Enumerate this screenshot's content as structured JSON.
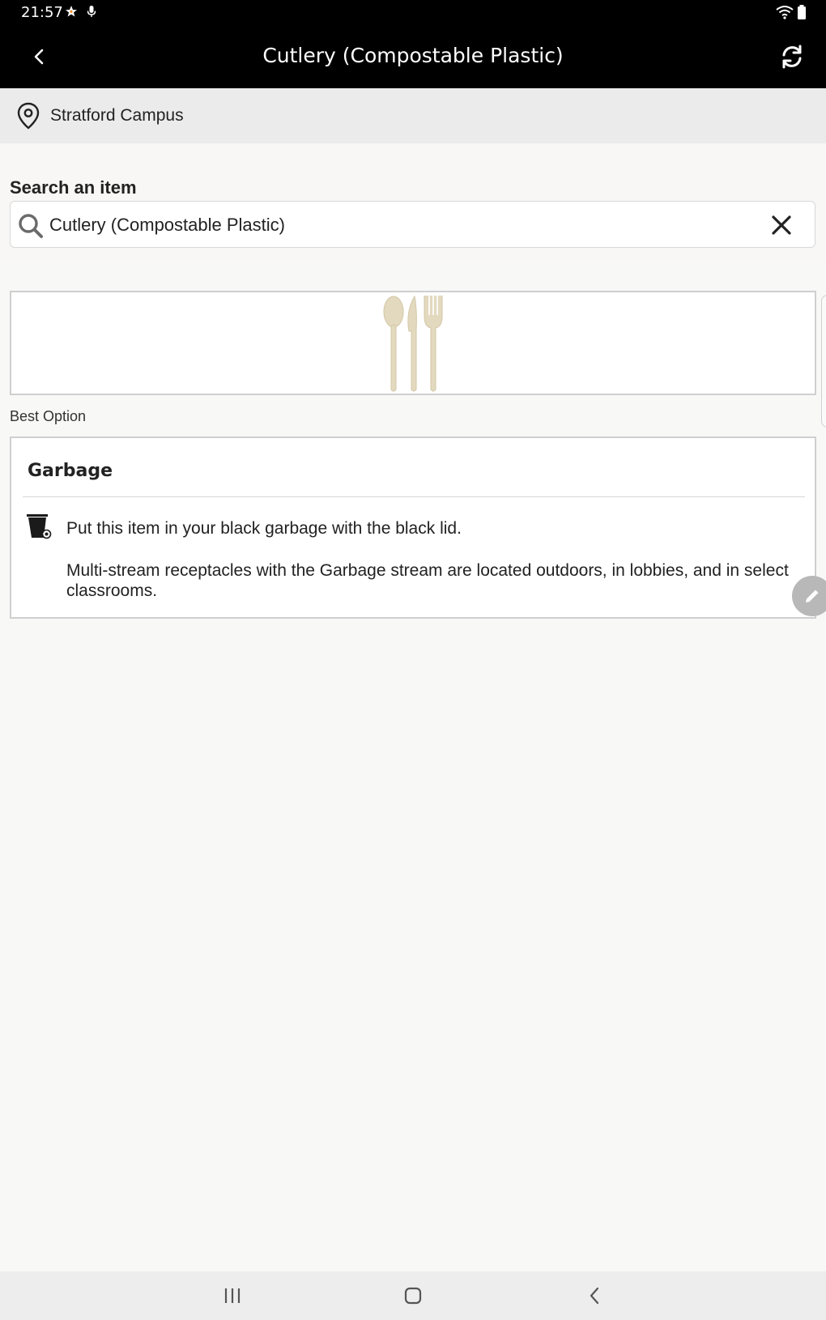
{
  "status_bar": {
    "time": "21:57",
    "left_icons": [
      "star-icon",
      "mic-icon"
    ],
    "right_icons": [
      "wifi-icon",
      "battery-icon"
    ]
  },
  "app_bar": {
    "title": "Cutlery (Compostable Plastic)",
    "back_icon": "chevron-left-icon",
    "refresh_icon": "refresh-icon"
  },
  "location": {
    "icon": "location-pin-icon",
    "label": "Stratford Campus"
  },
  "search": {
    "label": "Search an item",
    "value": "Cutlery (Compostable Plastic)",
    "search_icon": "search-icon",
    "clear_icon": "close-icon"
  },
  "item_image": {
    "icon": "cutlery-icon"
  },
  "best_option_label": "Best Option",
  "disposal": {
    "title": "Garbage",
    "icon": "garbage-bin-icon",
    "instruction": "Put this item in your black garbage with the black lid.",
    "details": "Multi-stream receptacles with the Garbage stream are located outdoors, in lobbies, and in select classrooms."
  },
  "fab": {
    "icon": "edit-icon"
  },
  "nav_bar": {
    "buttons": [
      "recent-apps-icon",
      "home-icon",
      "back-icon"
    ]
  },
  "colors": {
    "app_bar_bg": "#000000",
    "location_bg": "#ebebeb",
    "page_bg": "#f8f8f7",
    "card_border": "#cfcfcf",
    "cutlery": "#e3d9bf"
  }
}
